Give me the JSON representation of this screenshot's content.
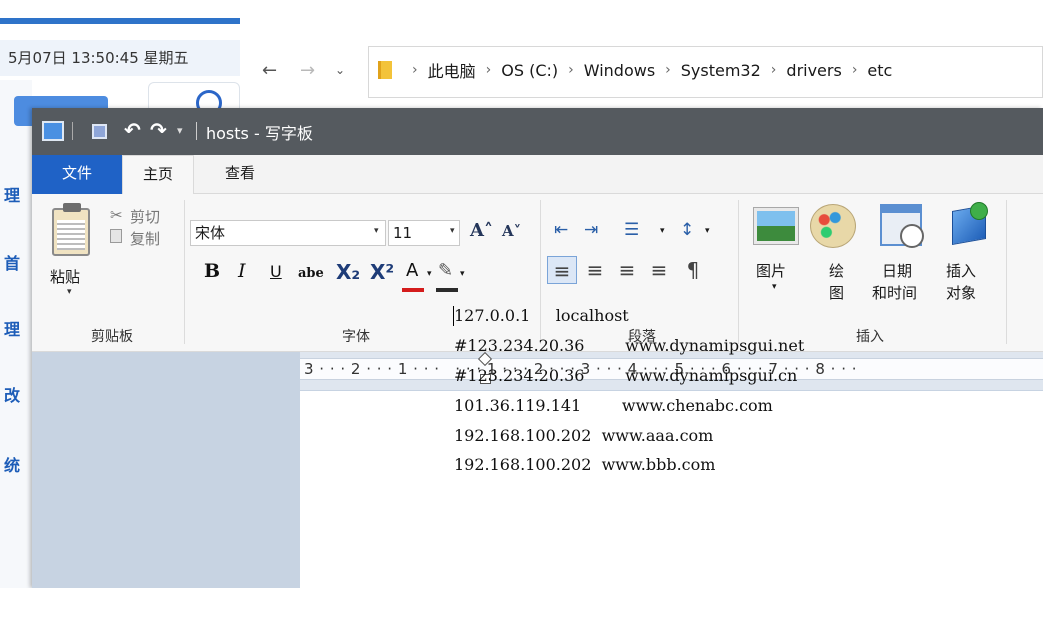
{
  "taskbar": {
    "datetime": "5月07日 13:50:45 星期五",
    "side_glyphs": [
      "理",
      "首",
      "理",
      "改",
      "统"
    ]
  },
  "explorer": {
    "back": "←",
    "forward": "→",
    "dropdown": "⌄",
    "separator": "›",
    "breadcrumb": [
      "此电脑",
      "OS (C:)",
      "Windows",
      "System32",
      "drivers",
      "etc"
    ]
  },
  "wordpad": {
    "window_title": "hosts - 写字板",
    "quick_access": {
      "undo": "↶",
      "redo": "↷",
      "dropdown": "▾"
    },
    "tabs": {
      "file": "文件",
      "home": "主页",
      "view": "查看"
    },
    "clipboard": {
      "paste": "粘贴",
      "cut": "剪切",
      "copy": "复制",
      "group_label": "剪贴板"
    },
    "font": {
      "font_name": "宋体",
      "font_size": "11",
      "grow": "A˄",
      "shrink": "A˅",
      "bold": "B",
      "italic": "I",
      "underline": "U",
      "strikethrough": "abe",
      "subscript": "X₂",
      "superscript": "X²",
      "font_color": "A",
      "highlight": "✎",
      "dropdown_arrow": "▾",
      "group_label": "字体"
    },
    "paragraph": {
      "decrease_indent": "⇤",
      "increase_indent": "⇥",
      "bullets": "☰",
      "line_spacing": "↕",
      "align_left": "≡",
      "align_center": "≡",
      "align_right": "≡",
      "align_justify": "≡",
      "settings": "¶",
      "group_label": "段落"
    },
    "insert": {
      "picture": "图片",
      "paint_1": "绘",
      "paint_2": "图",
      "datetime_1": "日期",
      "datetime_2": "和时间",
      "object_1": "插入",
      "object_2": "对象",
      "group_label": "插入"
    },
    "ruler": "3 · · · 2 · · · 1 · · ·   · · · 1 · · · 2 · · · 3 · · · 4 · · · 5 · · · 6 · · · 7 · · · 8 · · ·",
    "document_lines": [
      "127.0.0.1     localhost",
      "#123.234.20.36        www.dynamipsgui.net",
      "#123.234.20.36        www.dynamipsgui.cn",
      "101.36.119.141        www.chenabc.com",
      "192.168.100.202  www.aaa.com",
      "192.168.100.202  www.bbb.com"
    ]
  },
  "colors": {
    "titlebar": "#555a5f",
    "file_tab": "#1f62c6",
    "doc_background": "#c7d3e2"
  }
}
